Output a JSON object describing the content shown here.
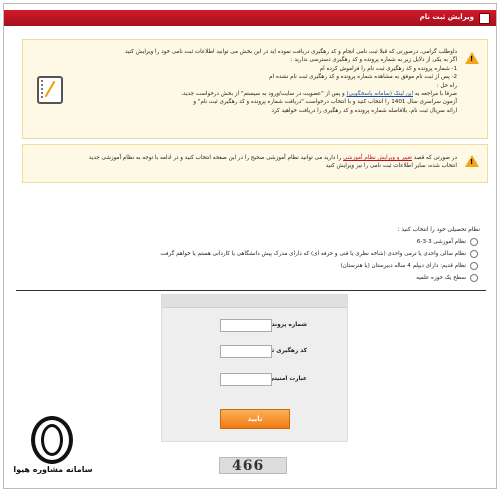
{
  "header": {
    "title": "ویرایش ثبت نام"
  },
  "notice1": {
    "lines": [
      "داوطلب گرامی، درصورتی که قبلا ثبت نامی انجام و کد رهگیری دریافت نموده اید در این بخش می توانید اطلاعات ثبت نامی خود را ویرایش کنید",
      "اگر به یکی از دلایل زیر به شماره پرونده و کد رهگیری دسترسی ندارید :",
      "1- شماره پرونده و کد رهگیری ثبت نام را فراموش کرده ام",
      "2- پس از ثبت نام موفق به مشاهده شماره پرونده و کد رهگیری ثبت نام نشده ام",
      "راه حل :",
      "صرفا با مراجعه به",
      "آزمون سراسری سال 1401 را انتخاب کنید و با انتخاب درخواست \"دریافت شماره پرونده و کد رهگیری ثبت نام\" و",
      "ارائه سریال ثبت نام، بلافاصله شماره پرونده و کد رهگیری را دریافت خواهید کرد"
    ],
    "link_text": "این لینک (سامانه پاسخگویی)",
    "after_link": "و پس از \"عضویت در سایت/ورود به سیستم\" از بخش درخواست جدید،"
  },
  "notice2": {
    "prefix": "در صورتی که قصد",
    "link_text": "تغییر و ویرایش نظام آموزشی",
    "rest1": "را دارید می توانید نظام آموزشی صحیح را در این صفحه انتخاب کنید و در ادامه با توجه به نظام آموزشی جدید",
    "rest2": "انتخاب شده، سایر اطلاعات ثبت نامی را نیز ویرایش کنید"
  },
  "question": "نظام تحصیلی خود را انتخاب کنید :",
  "options": [
    "نظام آموزشی 3-3-6",
    "نظام سالی واحدی یا ترمی واحدی (شاخه نظری یا فنی و حرفه ای) که دارای مدرک پیش دانشگاهی یا کاردانی هستم یا خواهم گرفت",
    "نظام قدیم: دارای دیپلم 4 ساله دبیرستان (یا هنرستان)",
    "سطح یک حوزه علمیه"
  ],
  "form": {
    "case_label": "شماره پرونده",
    "tracking_label": "کد رهگیری ثبت نام",
    "security_label": "عبارت امنیتی",
    "submit": "تایید"
  },
  "captcha_text": "466",
  "watermark": "سامانه مشاوره هیوا",
  "colors": {
    "header": "#c8162a",
    "warning": "#f3a417",
    "button": "#f58a1f",
    "link": "#1a4fb0"
  }
}
